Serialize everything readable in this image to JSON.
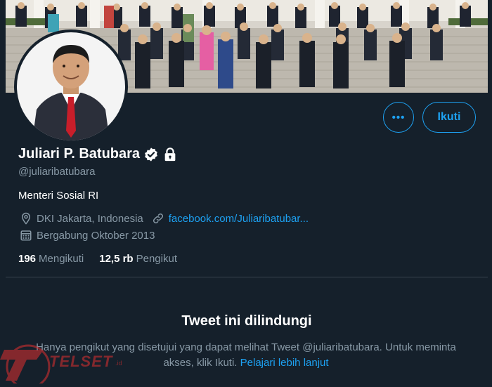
{
  "profile": {
    "display_name": "Juliari P. Batubara",
    "handle": "@juliaribatubara",
    "bio": "Menteri Sosial RI",
    "location": "DKI Jakarta, Indonesia",
    "website": "facebook.com/Juliaribatubar...",
    "joined": "Bergabung Oktober 2013"
  },
  "stats": {
    "following_count": "196",
    "following_label": "Mengikuti",
    "followers_count": "12,5 rb",
    "followers_label": "Pengikut"
  },
  "actions": {
    "more_label": "•••",
    "follow_label": "Ikuti"
  },
  "protected": {
    "title": "Tweet ini dilindungi",
    "text": "Hanya pengikut yang disetujui yang dapat melihat Tweet @juliaribatubara. Untuk meminta akses, klik Ikuti.",
    "learn_more": "Pelajari lebih lanjut"
  },
  "watermark": {
    "brand": "TELSET",
    "suffix": ".id"
  },
  "colors": {
    "background": "#15202b",
    "accent": "#1da1f2",
    "secondary_text": "#8899a6",
    "divider": "#38444d"
  },
  "icons": {
    "verified": "verified-badge-icon",
    "protected": "lock-icon",
    "location": "location-pin-icon",
    "link": "link-icon",
    "calendar": "calendar-icon"
  }
}
